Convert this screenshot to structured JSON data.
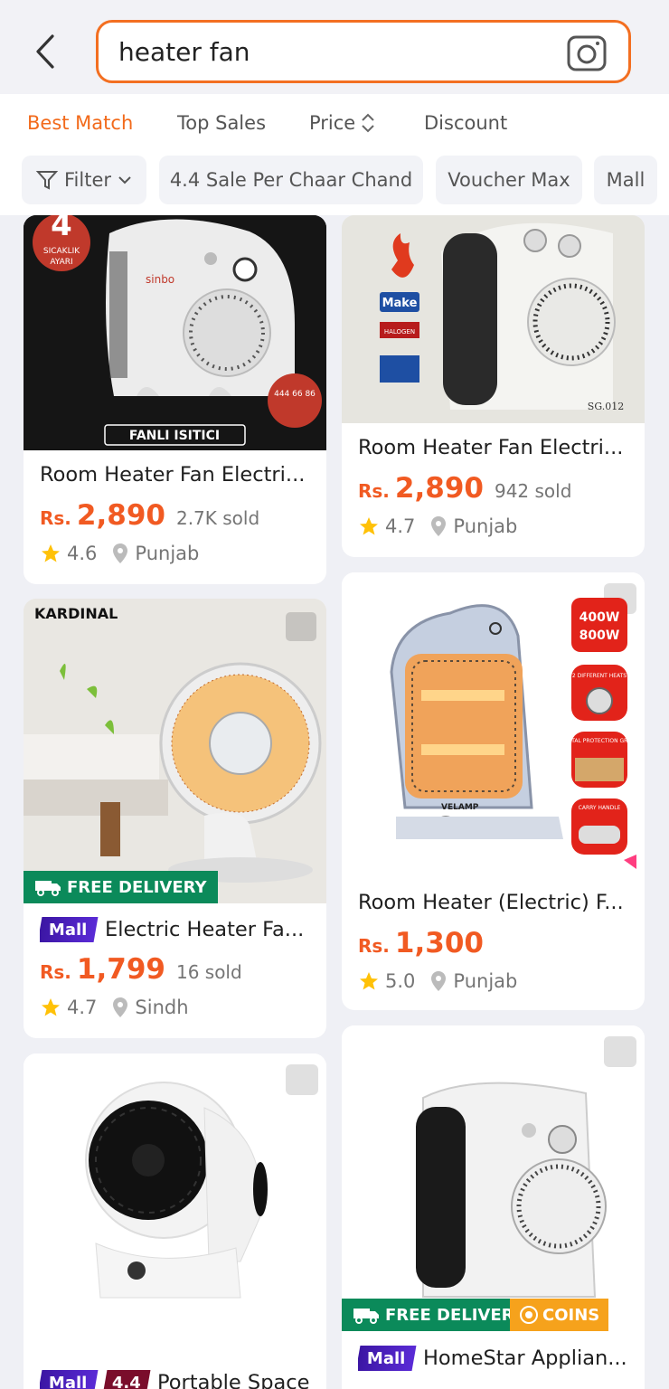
{
  "search": {
    "query": "heater fan"
  },
  "sort_tabs": [
    {
      "label": "Best Match",
      "active": true
    },
    {
      "label": "Top Sales",
      "active": false
    },
    {
      "label": "Price",
      "active": false
    },
    {
      "label": "Discount",
      "active": false
    }
  ],
  "chips": {
    "filter": "Filter",
    "sale": "4.4 Sale Per Chaar Chand",
    "voucher": "Voucher Max",
    "mall": "Mall"
  },
  "products": [
    {
      "title": "Room Heater Fan Electri...",
      "currency": "Rs.",
      "price": "2,890",
      "sold": "2.7K sold",
      "rating": "4.6",
      "location": "Punjab",
      "image_text": {
        "badge": "4",
        "badge_sub": "SICAKLIK AYARI",
        "brand": "sinbo",
        "caption": "FANLI ISITICI",
        "stamp": "444 66 86"
      }
    },
    {
      "title": "Room Heater Fan Electri...",
      "currency": "Rs.",
      "price": "2,890",
      "sold": "942 sold",
      "rating": "4.7",
      "location": "Punjab",
      "image_text": {
        "tag": "Make",
        "tag2": "HALOGEN",
        "model": "SG.012"
      }
    },
    {
      "title": "Electric Heater Fa...",
      "currency": "Rs.",
      "price": "1,799",
      "sold": "16 sold",
      "rating": "4.7",
      "location": "Sindh",
      "mall": "Mall",
      "free_delivery": "FREE DELIVERY",
      "image_text": {
        "brand": "KARDINAL"
      }
    },
    {
      "title": "Room Heater (Electric) F...",
      "currency": "Rs.",
      "price": "1,300",
      "sold": "",
      "rating": "5.0",
      "location": "Punjab",
      "image_text": {
        "watt": "400W",
        "watt2": "800W",
        "f1": "2 DIFFERENT HEATS",
        "f2": "METAL PROTECTION GRILL",
        "f3": "CARRY HANDLE",
        "brand": "VELAMP"
      }
    },
    {
      "title": "Portable Space",
      "mall": "Mall",
      "badge2": "4.4"
    },
    {
      "title": "HomeStar Applian...",
      "mall": "Mall",
      "free_delivery": "FREE DELIVERY",
      "coins": "COINS"
    }
  ]
}
